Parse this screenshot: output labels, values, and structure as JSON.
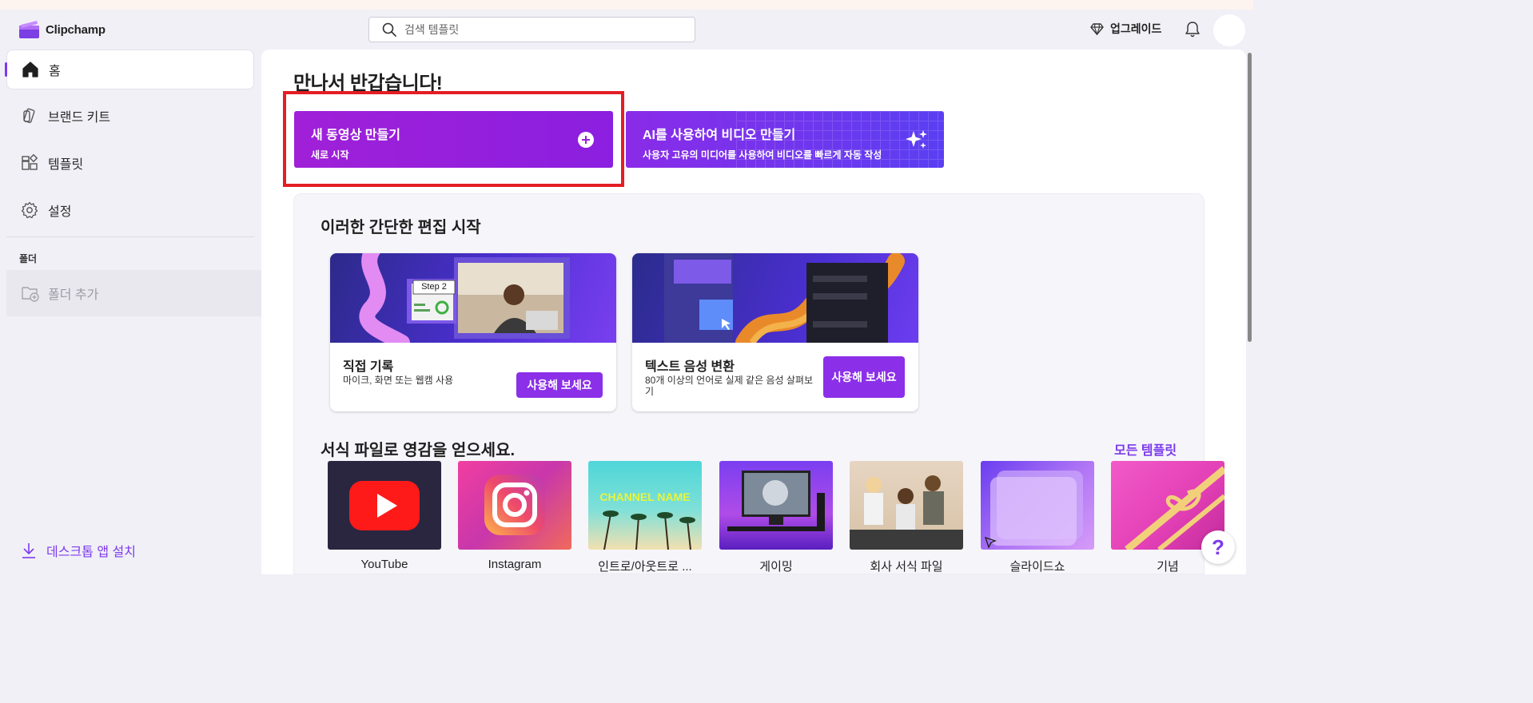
{
  "app": {
    "name": "Clipchamp"
  },
  "search": {
    "placeholder": "검색 템플릿"
  },
  "header": {
    "upgrade_label": "업그레이드"
  },
  "sidebar": {
    "items": [
      {
        "label": "홈",
        "icon": "home-icon",
        "active": true
      },
      {
        "label": "브랜드 키트",
        "icon": "brand-kit-icon"
      },
      {
        "label": "템플릿",
        "icon": "templates-icon"
      },
      {
        "label": "설정",
        "icon": "gear-icon"
      }
    ],
    "folders_heading": "폴더",
    "add_folder_label": "폴더 추가",
    "desktop_install_label": "데스크톱 앱 설치"
  },
  "main": {
    "greeting": "만나서 반갑습니다!",
    "new_video": {
      "title": "새 동영상 만들기",
      "subtitle": "새로 시작"
    },
    "ai_video": {
      "title": "AI를 사용하여 비디오 만들기",
      "subtitle": "사용자 고유의 미디어를 사용하여 비디오를 빠르게 자동 작성"
    },
    "easy_edits": {
      "title": "이러한 간단한 편집 시작",
      "cards": [
        {
          "name": "직접 기록",
          "description": "마이크, 화면 또는 웹캠 사용",
          "button_label": "사용해 보세요",
          "image_caption": "Step 2"
        },
        {
          "name": "텍스트 음성 변환",
          "description": "80개 이상의 언어로 실제 같은 음성 살펴보기",
          "button_label": "사용해 보세요"
        }
      ]
    },
    "templates": {
      "title": "서식 파일로 영감을 얻으세요.",
      "all_label": "모든 템플릿",
      "items": [
        {
          "label": "YouTube"
        },
        {
          "label": "Instagram"
        },
        {
          "label": "인트로/아웃트로 ...",
          "image_text": "CHANNEL NAME"
        },
        {
          "label": "게이밍"
        },
        {
          "label": "회사 서식 파일"
        },
        {
          "label": "슬라이드쇼"
        },
        {
          "label": "기념"
        }
      ]
    }
  },
  "help": {
    "label": "?"
  },
  "colors": {
    "accent": "#7c3aed",
    "highlight_border": "#e31e24",
    "button_purple": "#8b2fe8"
  }
}
